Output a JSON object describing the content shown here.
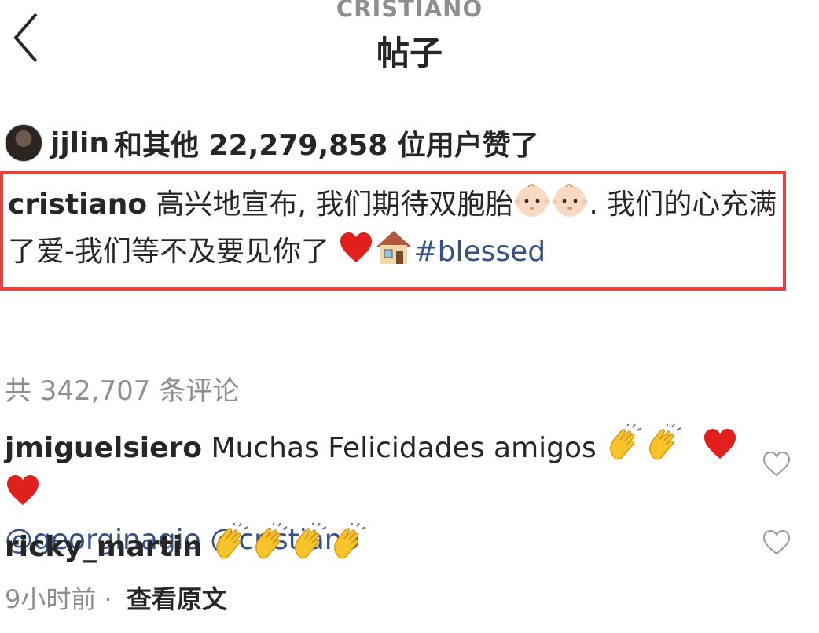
{
  "header": {
    "account": "CRISTIANO",
    "title": "帖子"
  },
  "likes": {
    "username": "jjlin",
    "text": "和其他 22,279,858 位用户赞了"
  },
  "post": {
    "username": "cristiano",
    "text_part1": " 高兴地宣布, 我们期待双胞胎",
    "text_part2": ". 我们的心充满了爱-我们等不及要见你了 ",
    "hashtag": "#blessed"
  },
  "comments_count": "共 342,707 条评论",
  "comments": [
    {
      "username": "jmiguelsiero",
      "text": " Muchas Felicidades amigos ",
      "mention1": "@georginagio",
      "mention2": "@cristiano"
    },
    {
      "username": "ricky_martin"
    }
  ],
  "meta": {
    "time": "9小时前",
    "separator": " · ",
    "see_original": "查看原文"
  },
  "colors": {
    "highlight_border": "#e8413b",
    "link": "#385185",
    "muted": "#8e8e8e"
  },
  "icons": [
    "back-chevron-icon",
    "baby-emoji-icon",
    "heart-emoji-icon",
    "house-emoji-icon",
    "clap-emoji-icon",
    "heart-outline-icon"
  ]
}
